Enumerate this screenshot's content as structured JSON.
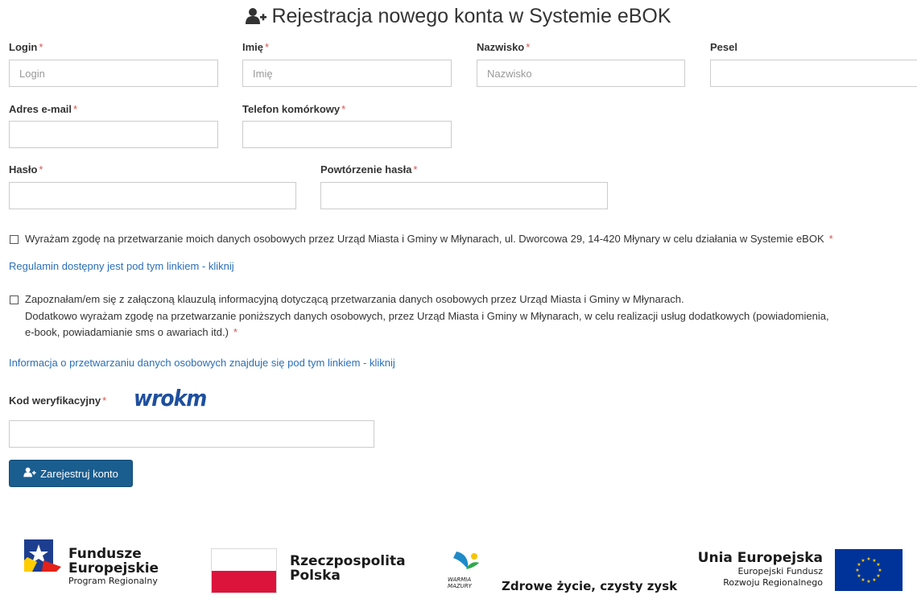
{
  "page": {
    "title": "Rejestracja nowego konta w Systemie eBOK"
  },
  "form": {
    "required_mark": "*",
    "login": {
      "label": "Login",
      "placeholder": "Login",
      "value": ""
    },
    "imie": {
      "label": "Imię",
      "placeholder": "Imię",
      "value": ""
    },
    "nazwisko": {
      "label": "Nazwisko",
      "placeholder": "Nazwisko",
      "value": ""
    },
    "pesel": {
      "label": "Pesel",
      "placeholder": "",
      "value": ""
    },
    "email": {
      "label": "Adres e-mail",
      "placeholder": "",
      "value": ""
    },
    "telefon": {
      "label": "Telefon komórkowy",
      "placeholder": "",
      "value": ""
    },
    "haslo": {
      "label": "Hasło",
      "placeholder": "",
      "value": ""
    },
    "powtorzenie": {
      "label": "Powtórzenie hasła",
      "placeholder": "",
      "value": ""
    },
    "consent1": {
      "text": "Wyrażam zgodę na przetwarzanie moich danych osobowych przez Urząd Miasta i Gminy w Młynarach, ul. Dworcowa 29, 14-420 Młynary w celu działania w Systemie eBOK",
      "checked": false
    },
    "regulamin_link": "Regulamin dostępny jest pod tym linkiem - kliknij",
    "consent2": {
      "line1": "Zapoznałam/em się z załączoną klauzulą informacyjną dotyczącą przetwarzania danych osobowych przez Urząd Miasta i Gminy w Młynarach.",
      "line2": "Dodatkowo wyrażam zgodę na przetwarzanie poniższych danych osobowych, przez Urząd Miasta i Gminy w Młynarach, w celu realizacji usług dodatkowych (powiadomienia,",
      "line3": "e-book, powiadamianie sms o awariach itd.)",
      "checked": false
    },
    "info_link": "Informacja o przetwarzaniu danych osobowych znajduje się pod tym linkiem - kliknij",
    "kod": {
      "label": "Kod weryfikacyjny",
      "captcha": "wrokm",
      "value": "",
      "placeholder": ""
    },
    "submit_label": "Zarejestruj konto"
  },
  "footer": {
    "fe": {
      "line1": "Fundusze",
      "line2": "Europejskie",
      "line3": "Program Regionalny"
    },
    "rp": {
      "line1": "Rzeczpospolita",
      "line2": "Polska"
    },
    "wm": {
      "mark1": "WARMIA",
      "mark2": "MAZURY",
      "slogan": "Zdrowe życie, czysty zysk"
    },
    "ue": {
      "line1": "Unia Europejska",
      "line2": "Europejski Fundusz",
      "line3": "Rozwoju Regionalnego"
    }
  },
  "colors": {
    "link": "#2a6fb7",
    "button": "#1a5d8f",
    "required": "#d9534f",
    "eu_blue": "#003399",
    "eu_star": "#ffcc00",
    "pl_red": "#dc143c"
  }
}
